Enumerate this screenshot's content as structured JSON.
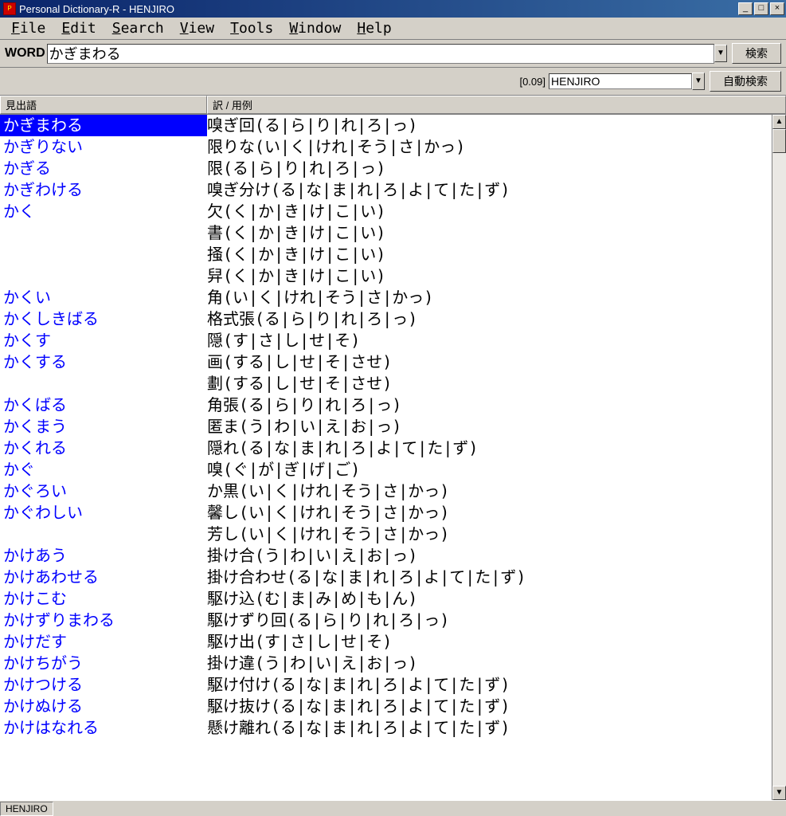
{
  "window": {
    "title": "Personal Dictionary-R - HENJIRO"
  },
  "menu": [
    "File",
    "Edit",
    "Search",
    "View",
    "Tools",
    "Window",
    "Help"
  ],
  "searchbar": {
    "label": "WORD",
    "value": "かぎまわる",
    "search_btn": "検索"
  },
  "subbar": {
    "time": "[0.09]",
    "dict": "HENJIRO",
    "auto_btn": "自動検索"
  },
  "columns": {
    "c1": "見出語",
    "c2": "訳 / 用例"
  },
  "entries": [
    {
      "word": "かぎまわる",
      "defs": [
        "嗅ぎ回(る|ら|り|れ|ろ|っ)"
      ],
      "selected": true
    },
    {
      "word": "かぎりない",
      "defs": [
        "限りな(い|く|けれ|そう|さ|かっ)"
      ]
    },
    {
      "word": "かぎる",
      "defs": [
        "限(る|ら|り|れ|ろ|っ)"
      ]
    },
    {
      "word": "かぎわける",
      "defs": [
        "嗅ぎ分け(る|な|ま|れ|ろ|よ|て|た|ず)"
      ]
    },
    {
      "word": "かく",
      "defs": [
        "欠(く|か|き|け|こ|い)",
        "書(く|か|き|け|こ|い)",
        "掻(く|か|き|け|こ|い)",
        "舁(く|か|き|け|こ|い)"
      ]
    },
    {
      "word": "かくい",
      "defs": [
        "角(い|く|けれ|そう|さ|かっ)"
      ]
    },
    {
      "word": "かくしきばる",
      "defs": [
        "格式張(る|ら|り|れ|ろ|っ)"
      ]
    },
    {
      "word": "かくす",
      "defs": [
        "隠(す|さ|し|せ|そ)"
      ]
    },
    {
      "word": "かくする",
      "defs": [
        "画(する|し|せ|そ|させ)",
        "劃(する|し|せ|そ|させ)"
      ]
    },
    {
      "word": "かくばる",
      "defs": [
        "角張(る|ら|り|れ|ろ|っ)"
      ]
    },
    {
      "word": "かくまう",
      "defs": [
        "匿ま(う|わ|い|え|お|っ)"
      ]
    },
    {
      "word": "かくれる",
      "defs": [
        "隠れ(る|な|ま|れ|ろ|よ|て|た|ず)"
      ]
    },
    {
      "word": "かぐ",
      "defs": [
        "嗅(ぐ|が|ぎ|げ|ご)"
      ]
    },
    {
      "word": "かぐろい",
      "defs": [
        "か黒(い|く|けれ|そう|さ|かっ)"
      ]
    },
    {
      "word": "かぐわしい",
      "defs": [
        "馨し(い|く|けれ|そう|さ|かっ)",
        "芳し(い|く|けれ|そう|さ|かっ)"
      ]
    },
    {
      "word": "かけあう",
      "defs": [
        "掛け合(う|わ|い|え|お|っ)"
      ]
    },
    {
      "word": "かけあわせる",
      "defs": [
        "掛け合わせ(る|な|ま|れ|ろ|よ|て|た|ず)"
      ]
    },
    {
      "word": "かけこむ",
      "defs": [
        "駆け込(む|ま|み|め|も|ん)"
      ]
    },
    {
      "word": "かけずりまわる",
      "defs": [
        "駆けずり回(る|ら|り|れ|ろ|っ)"
      ]
    },
    {
      "word": "かけだす",
      "defs": [
        "駆け出(す|さ|し|せ|そ)"
      ]
    },
    {
      "word": "かけちがう",
      "defs": [
        "掛け違(う|わ|い|え|お|っ)"
      ]
    },
    {
      "word": "かけつける",
      "defs": [
        "駆け付け(る|な|ま|れ|ろ|よ|て|た|ず)"
      ]
    },
    {
      "word": "かけぬける",
      "defs": [
        "駆け抜け(る|な|ま|れ|ろ|よ|て|た|ず)"
      ]
    },
    {
      "word": "かけはなれる",
      "defs": [
        "懸け離れ(る|な|ま|れ|ろ|よ|て|た|ず)"
      ]
    }
  ],
  "status": "HENJIRO"
}
